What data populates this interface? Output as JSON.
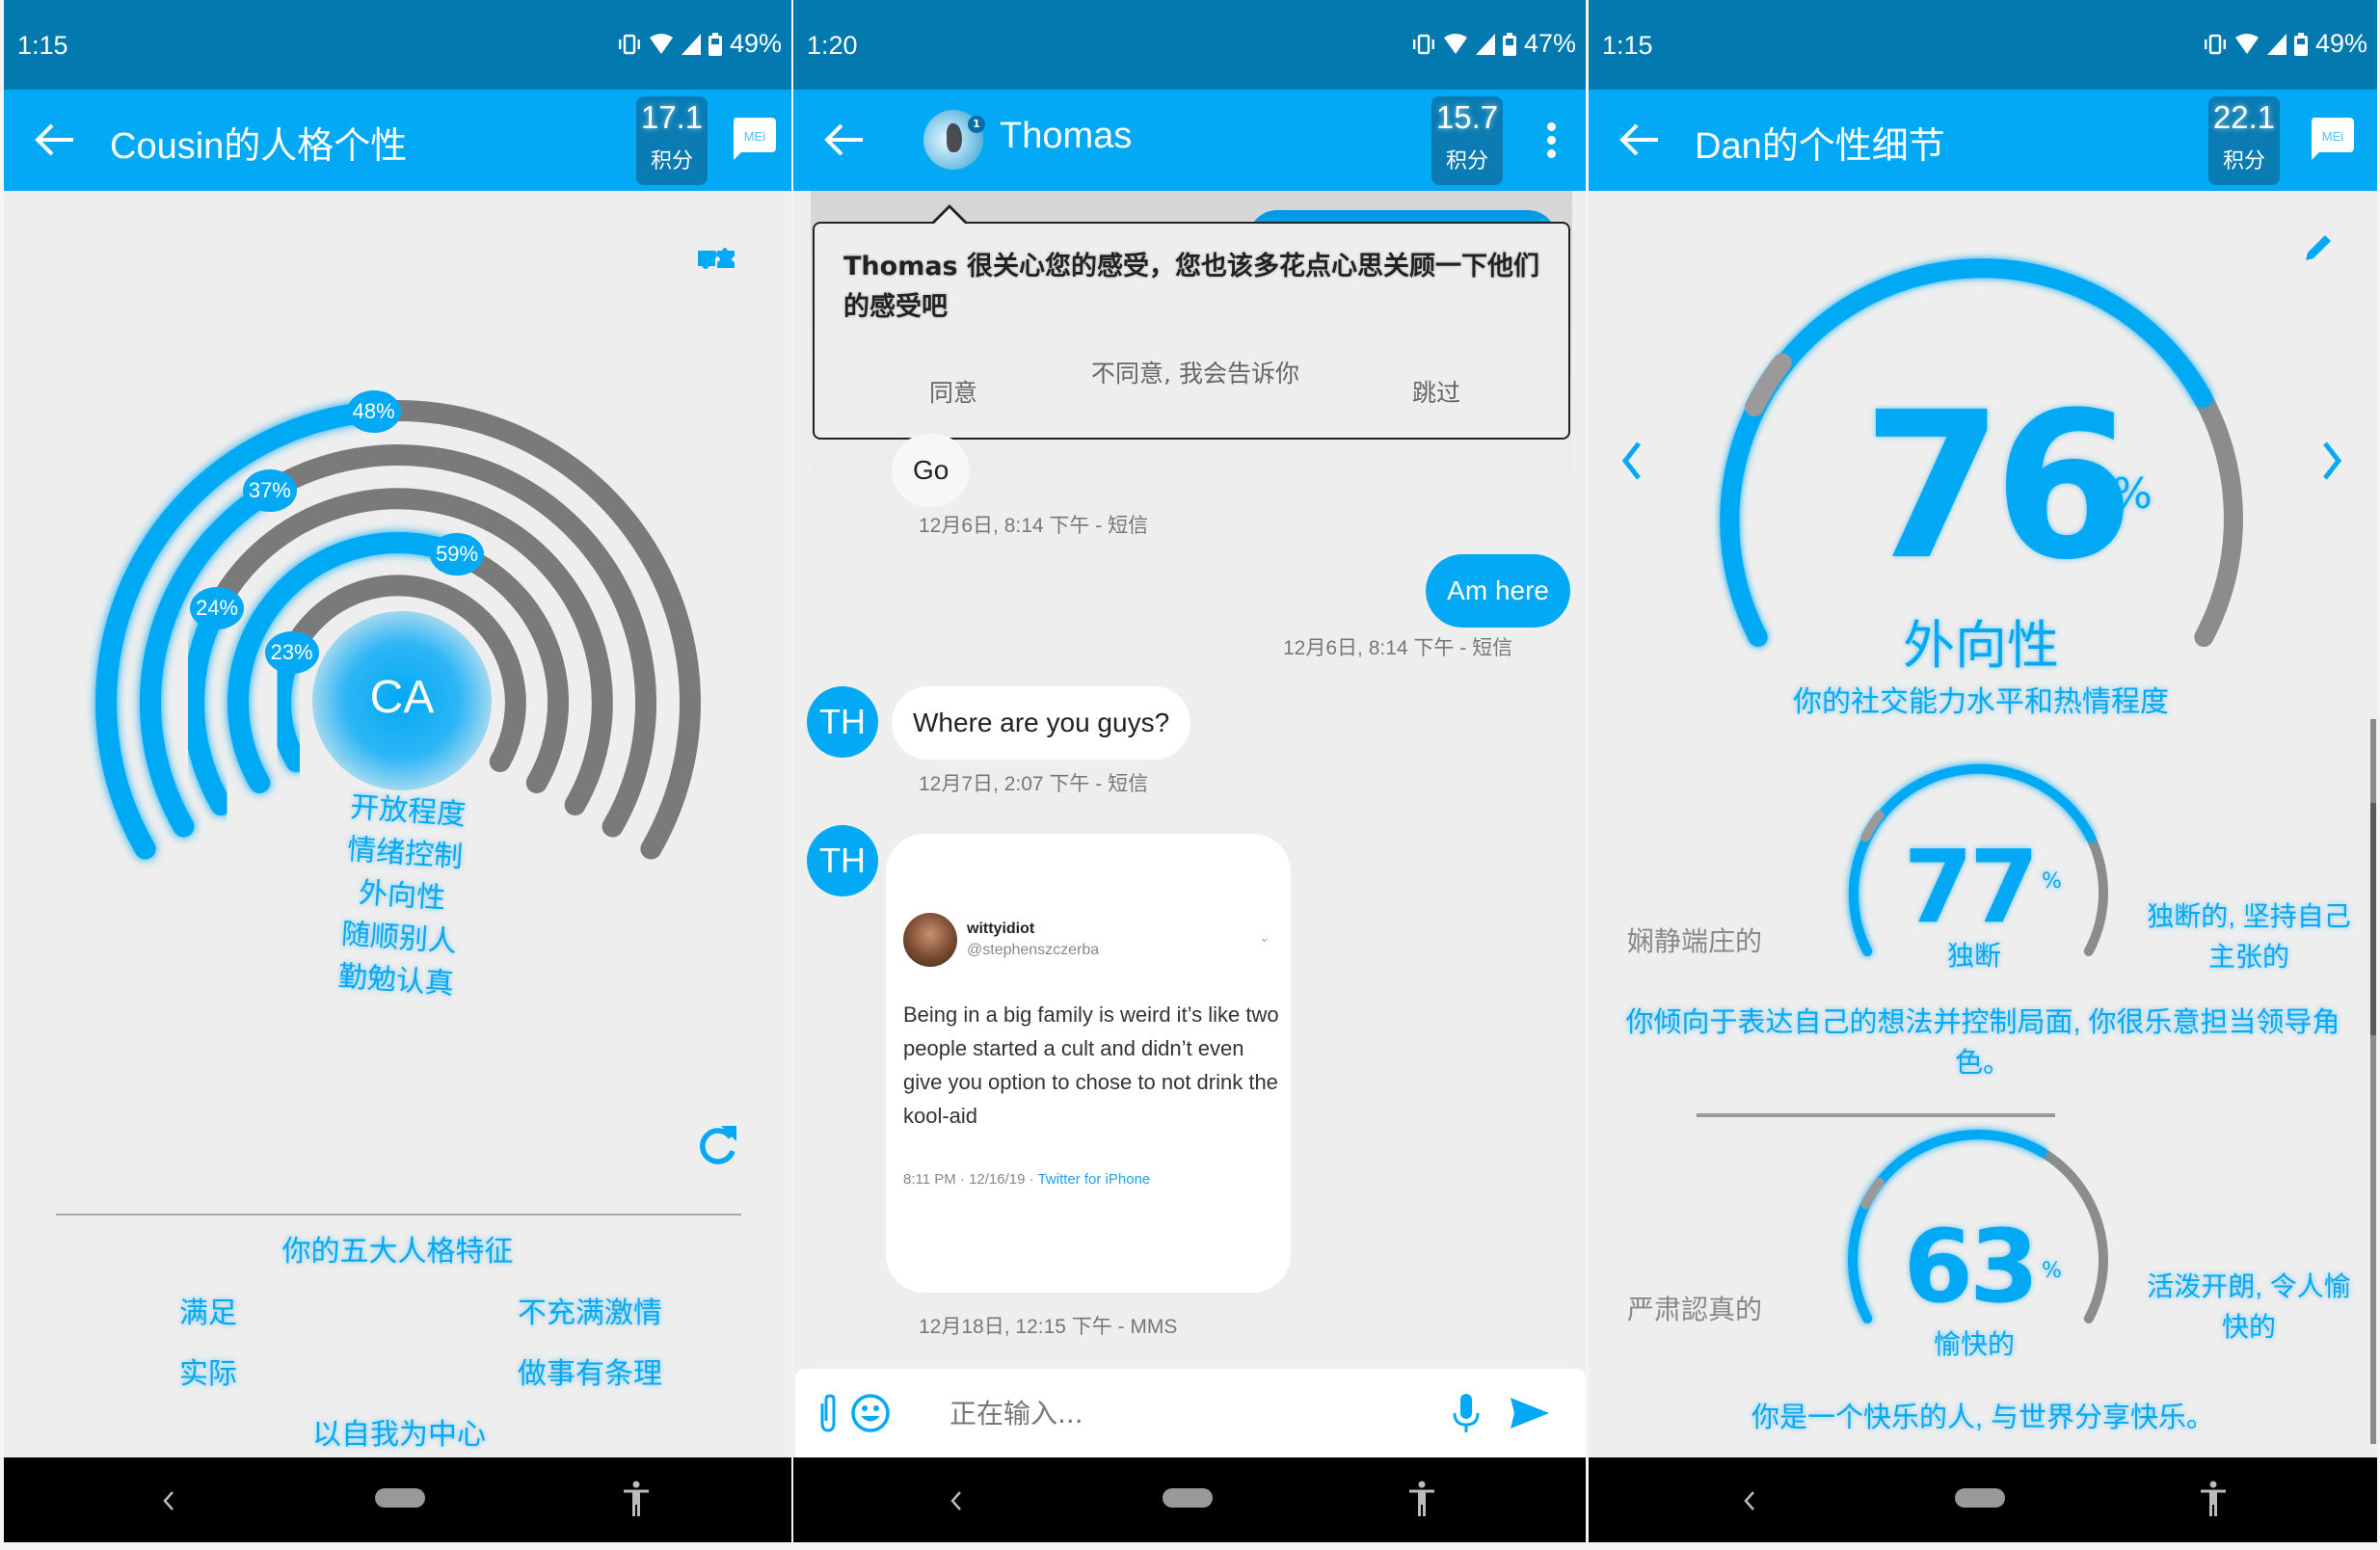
{
  "colors": {
    "accent": "#03a9f4",
    "status_bar": "#0479b0",
    "app_bar": "#03a9f4",
    "score_box": "#0a7cb3",
    "track_gray": "#7a7a7a"
  },
  "panels": [
    {
      "status": {
        "time": "1:15",
        "battery": "49%"
      },
      "header": {
        "title": "Cousin的人格个性",
        "score": "17.1",
        "score_label": "积分",
        "mei_label": "MEi"
      },
      "center_initials": "CA",
      "rings": [
        {
          "trait": "开放程度",
          "percent": 48,
          "label": "48%"
        },
        {
          "trait": "情绪控制",
          "percent": 37,
          "label": "37%"
        },
        {
          "trait": "外向性",
          "percent": 24,
          "label": "24%"
        },
        {
          "trait": "随顺别人",
          "percent": 59,
          "label": "59%"
        },
        {
          "trait": "勤勉认真",
          "percent": 23,
          "label": "23%"
        }
      ],
      "big5": {
        "title": "你的五大人格特征",
        "items": [
          "满足",
          "不充满激情",
          "实际",
          "做事有条理",
          "以自我为中心"
        ]
      }
    },
    {
      "status": {
        "time": "1:20",
        "battery": "47%"
      },
      "header": {
        "contact": "Thomas",
        "avatar_badge": "1",
        "score": "15.7",
        "score_label": "积分"
      },
      "popup": {
        "message": "Thomas 很关心您的感受，您也该多花点心思关顾一下他们的感受吧",
        "buttons": [
          "同意",
          "不同意, 我会告诉你",
          "跳过"
        ]
      },
      "messages": [
        {
          "type": "received",
          "text": "Go",
          "meta": "12月6日, 8:14 下午  - 短信"
        },
        {
          "type": "sent",
          "text": "Am here",
          "meta": "12月6日, 8:14 下午  - 短信"
        },
        {
          "type": "received",
          "avatar": "TH",
          "text": "Where are you guys?",
          "meta": "12月7日, 2:07 下午  - 短信"
        },
        {
          "type": "received_image",
          "avatar": "TH",
          "meta": "12月18日, 12:15 下午  - MMS",
          "tweet": {
            "name": "wittyidiot",
            "handle": "@stephenszczerba",
            "text": "Being in a big family is weird it’s like two people started a cult and didn’t even give you option to chose to not drink the kool-aid",
            "time": "8:11 PM · 12/16/19 · ",
            "source": "Twitter for iPhone"
          }
        }
      ],
      "composer": {
        "placeholder": "正在输入..."
      }
    },
    {
      "status": {
        "time": "1:15",
        "battery": "49%"
      },
      "header": {
        "title": "Dan的个性细节",
        "score": "22.1",
        "score_label": "积分",
        "mei_label": "MEi"
      },
      "main_gauge": {
        "value": 76,
        "value_text": "76",
        "pct": "%",
        "trait": "外向性",
        "description": "你的社交能力水平和热情程度"
      },
      "gauges": [
        {
          "value": 77,
          "value_text": "77",
          "pct": "%",
          "trait": "独断",
          "left_label": "娴静端庄的",
          "right_label": "独断的, 坚持自己主张的",
          "description": "你倾向于表达自己的想法并控制局面, 你很乐意担当领导角色。"
        },
        {
          "value": 63,
          "value_text": "63",
          "pct": "%",
          "trait": "愉快的",
          "left_label": "严肃認真的",
          "right_label": "活泼开朗, 令人愉快的",
          "description": "你是一个快乐的人, 与世界分享快乐。"
        }
      ]
    }
  ]
}
